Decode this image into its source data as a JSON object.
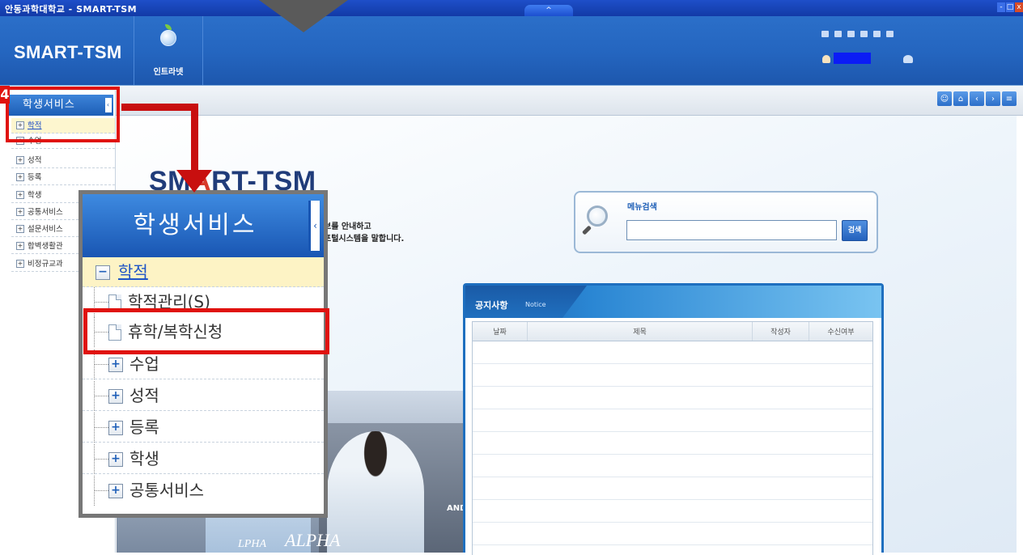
{
  "window": {
    "title": "안동과학대학교 - SMART-TSM",
    "collapse_glyph": "^",
    "minimize": "-",
    "restore": "□",
    "close": "x"
  },
  "header": {
    "brand": "SMART-TSM",
    "intranet_label": "인트라넷"
  },
  "nav_icons": [
    "people-icon",
    "home-icon",
    "prev-icon",
    "next-icon",
    "list-icon"
  ],
  "sidebar": {
    "title": "학생서비스",
    "toggle": "‹",
    "items": [
      {
        "label": "학적",
        "icon": "+",
        "active": true
      },
      {
        "label": "수업",
        "icon": "+"
      },
      {
        "label": "성적",
        "icon": "+"
      },
      {
        "label": "등록",
        "icon": "+"
      },
      {
        "label": "학생",
        "icon": "+"
      },
      {
        "label": "공통서비스",
        "icon": "+"
      },
      {
        "label": "설문서비스",
        "icon": "+"
      },
      {
        "label": "합벽생활관",
        "icon": "+"
      },
      {
        "label": "비정규교과",
        "icon": "+"
      }
    ]
  },
  "annotation": {
    "step_number": "4"
  },
  "main": {
    "logo_prefix": "SM",
    "logo_highlight": "A",
    "logo_suffix": "RT-TSM",
    "intro_line1": "보를 안내하고",
    "intro_line2": "포털시스템을 말합니다.",
    "photo_text_1": "AND",
    "photo_text_2": "ALPHA",
    "photo_text_3": "LPHA"
  },
  "search": {
    "label": "메뉴검색",
    "value": "",
    "button": "검색"
  },
  "notice": {
    "title": "공지사항",
    "subtitle": "Notice",
    "columns": [
      "날짜",
      "제목",
      "작성자",
      "수신여부"
    ],
    "rows": 9
  },
  "zoom_menu": {
    "title": "학생서비스",
    "toggle": "‹",
    "items": [
      {
        "label": "학적",
        "icon": "−",
        "active": true,
        "kind": "folder"
      },
      {
        "label": "학적관리(S)",
        "kind": "page"
      },
      {
        "label": "휴학/복학신청",
        "kind": "page",
        "highlighted": true
      },
      {
        "label": "수업",
        "icon": "+",
        "kind": "folder"
      },
      {
        "label": "성적",
        "icon": "+",
        "kind": "folder"
      },
      {
        "label": "등록",
        "icon": "+",
        "kind": "folder"
      },
      {
        "label": "학생",
        "icon": "+",
        "kind": "folder"
      },
      {
        "label": "공통서비스",
        "icon": "+",
        "kind": "folder"
      }
    ]
  },
  "colors": {
    "header_blue": "#2465bf",
    "callout_red": "#e0120f",
    "active_row": "#fdf3c5"
  }
}
